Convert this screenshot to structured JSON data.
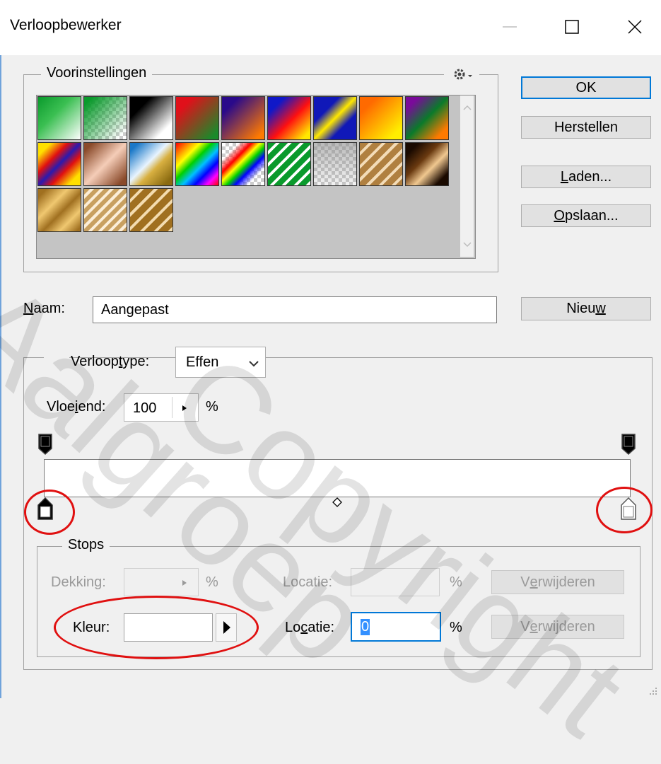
{
  "window": {
    "title": "Verloopbewerker"
  },
  "presets": {
    "title": "Voorinstellingen",
    "menu_icon": "gear-icon"
  },
  "buttons": {
    "ok": "OK",
    "reset": "Herstellen",
    "load_pre": "",
    "load_u": "L",
    "load_post": "aden...",
    "save_pre": "",
    "save_u": "O",
    "save_post": "psla​an...",
    "new_pre": "Nieu",
    "new_u": "w",
    "new_post": ""
  },
  "name": {
    "label_u": "N",
    "label_post": "aam:",
    "value": "Aangepast"
  },
  "gradient": {
    "type_label_pre": "Verloop",
    "type_label_u": "t",
    "type_label_post": "ype:",
    "type_value": "Effen",
    "smooth_label_pre": "Vloe",
    "smooth_label_u": "i",
    "smooth_label_post": "end:",
    "smooth_value": "100",
    "smooth_unit": "%",
    "bar_color": "#ffffff"
  },
  "stops": {
    "title": "Stops",
    "opacity_label": "Dekking:",
    "opacity_value": "",
    "opacity_unit": "%",
    "location1_label": "Locatie:",
    "location1_value": "",
    "location1_unit": "%",
    "delete1_pre": "V",
    "delete1_u": "e",
    "delete1_post": "rwijderen",
    "color_label": "Kleur:",
    "color_value": "#ffffff",
    "location2_label_pre": "Lo",
    "location2_label_u": "c",
    "location2_label_post": "atie:",
    "location2_value": "0",
    "location2_unit": "%",
    "delete2_pre": "V",
    "delete2_u": "e",
    "delete2_post": "rwijderen"
  },
  "watermark": {
    "line1": "Aalgroep",
    "line2": "Copyright"
  }
}
